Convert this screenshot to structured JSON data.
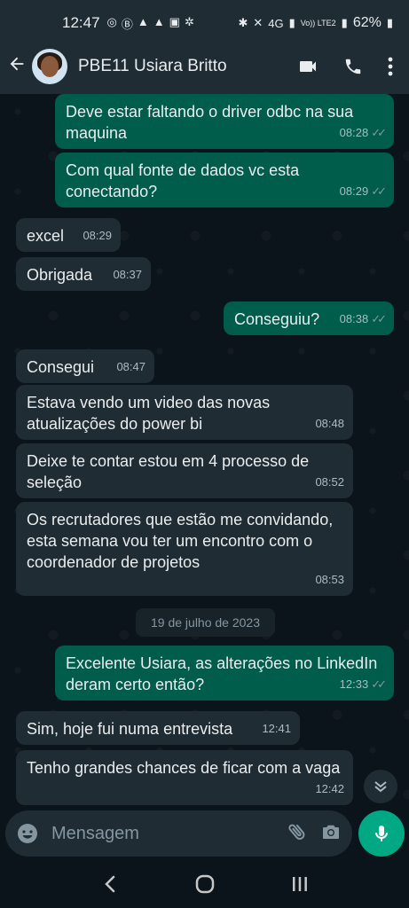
{
  "status_bar": {
    "time": "12:47",
    "network": "4G",
    "volte": "Vo)) LTE2",
    "battery": "62%"
  },
  "header": {
    "contact_name": "PBE11 Usiara Britto",
    "icons": [
      "back-arrow-icon",
      "avatar",
      "video-call-icon",
      "voice-call-icon",
      "more-options-icon"
    ]
  },
  "messages": [
    {
      "dir": "out",
      "text": "Deve estar faltando o driver odbc na sua maquina",
      "time": "08:28",
      "ticks": true
    },
    {
      "dir": "out",
      "text": "Com qual fonte de dados vc esta conectando?",
      "time": "08:29",
      "ticks": true
    },
    {
      "dir": "in",
      "text": "excel",
      "time": "08:29"
    },
    {
      "dir": "in",
      "text": "Obrigada",
      "time": "08:37"
    },
    {
      "dir": "out",
      "text": "Conseguiu?",
      "time": "08:38",
      "ticks": true
    },
    {
      "dir": "in",
      "text": "Consegui",
      "time": "08:47"
    },
    {
      "dir": "in",
      "text": "Estava vendo um video das novas atualizações do power bi",
      "time": "08:48"
    },
    {
      "dir": "in",
      "text": "Deixe te contar estou em 4 processo de seleção",
      "time": "08:52"
    },
    {
      "dir": "in",
      "text": "Os recrutadores que estão me convidando, esta semana vou ter um encontro com o coordenador de projetos",
      "time": "08:53"
    },
    {
      "dir": "out",
      "text": "Excelente Usiara, as alterações no LinkedIn deram certo então?",
      "time": "12:33",
      "ticks": true
    },
    {
      "dir": "in",
      "text": "Sim, hoje fui numa entrevista",
      "time": "12:41"
    },
    {
      "dir": "in",
      "text": "Tenho grandes chances de ficar com a vaga",
      "time": "12:42"
    }
  ],
  "date_separator": "19 de julho de 2023",
  "composer": {
    "placeholder": "Mensagem"
  },
  "colors": {
    "outgoing_bubble": "#005c4b",
    "incoming_bubble": "#202c33",
    "accent": "#00a884",
    "background": "#0b141a"
  }
}
